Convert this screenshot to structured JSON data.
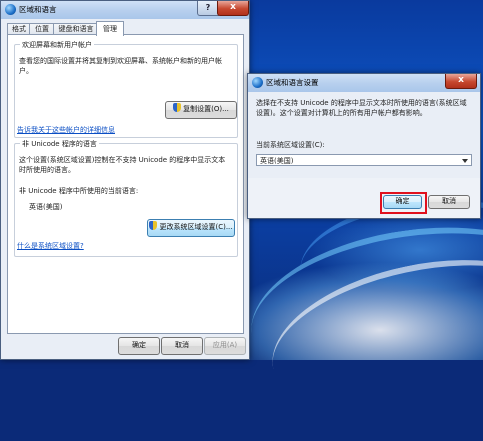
{
  "main_window": {
    "title": "区域和语言",
    "help": "?",
    "close": "x",
    "tabs": [
      {
        "label": "格式"
      },
      {
        "label": "位置"
      },
      {
        "label": "键盘和语言"
      },
      {
        "label": "管理"
      }
    ],
    "welcome_group": {
      "title": "欢迎屏幕和新用户帐户",
      "description": "查看您的国际设置并将其复制到欢迎屏幕、系统帐户和新的用户帐户。",
      "copy_button": "复制设置(O)...",
      "link": "告诉我关于这些帐户的详细信息"
    },
    "unicode_group": {
      "title": "非 Unicode 程序的语言",
      "description": "这个设置(系统区域设置)控制在不支持 Unicode 的程序中显示文本时所使用的语言。",
      "current_label": "非 Unicode 程序中所使用的当前语言:",
      "current_value": "英语(美国)",
      "change_button": "更改系统区域设置(C)...",
      "link": "什么是系统区域设置?"
    },
    "footer": {
      "ok": "确定",
      "cancel": "取消",
      "apply": "应用(A)"
    }
  },
  "sub_window": {
    "title": "区域和语言设置",
    "close": "x",
    "description": "选择在不支持 Unicode 的程序中显示文本时所使用的语言(系统区域设置)。这个设置对计算机上的所有用户帐户都有影响。",
    "locale_label": "当前系统区域设置(C):",
    "locale_value": "英语(美国)",
    "ok": "确定",
    "cancel": "取消"
  },
  "colors": {
    "highlight": "#e0101d",
    "link": "#0a4ec4"
  }
}
